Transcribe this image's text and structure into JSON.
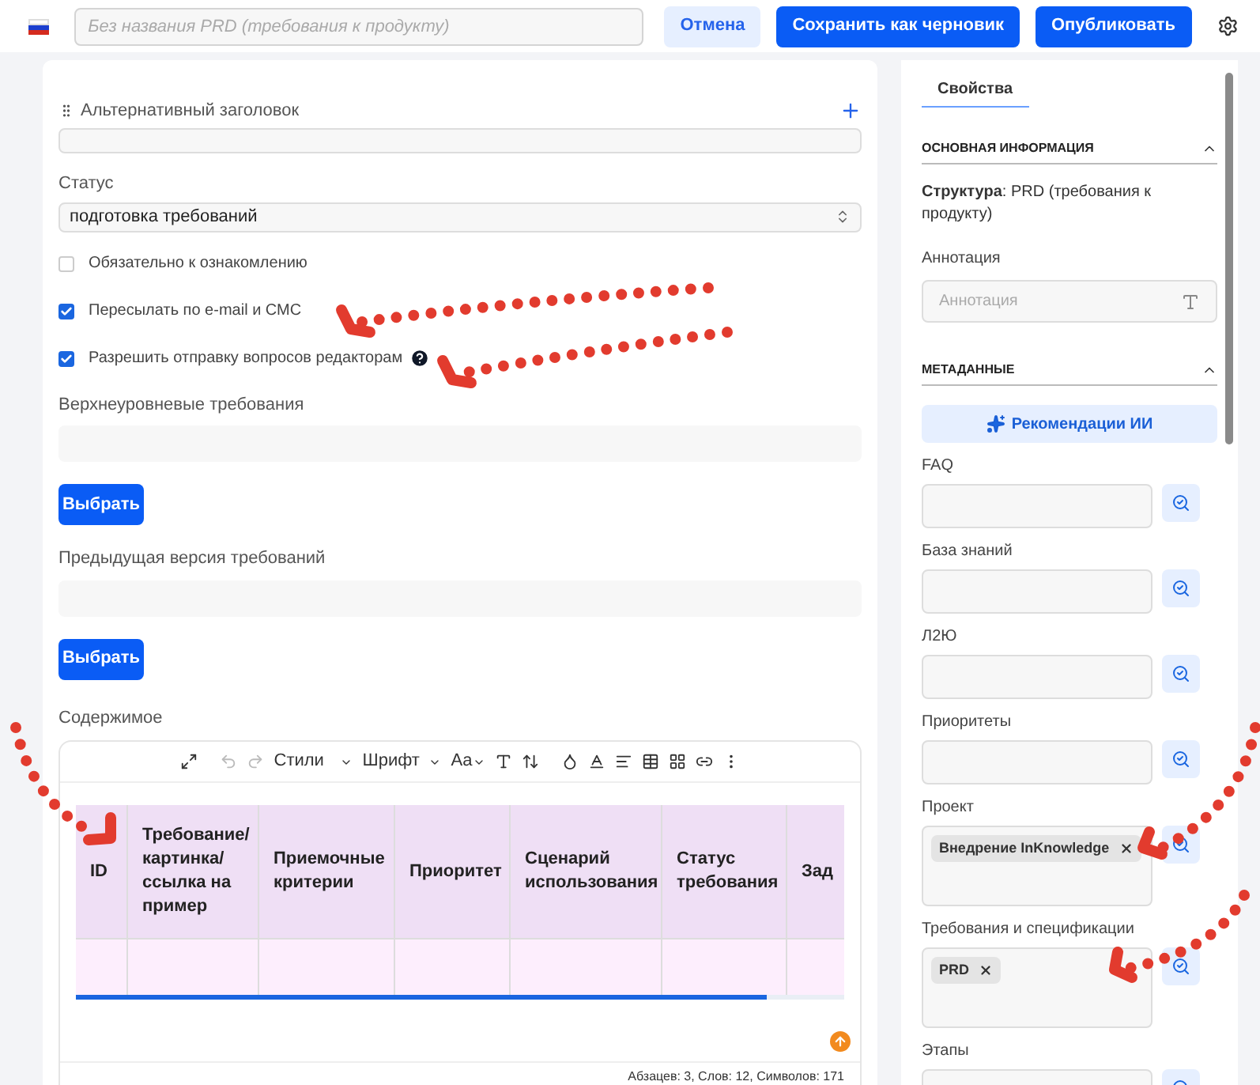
{
  "header": {
    "title_placeholder": "Без названия PRD (требования к продукту)",
    "buttons": [
      {
        "label": "Отмена",
        "kind": "secondary"
      },
      {
        "label": "Сохранить как черновик",
        "kind": "primary"
      },
      {
        "label": "Опубликовать",
        "kind": "primary"
      }
    ]
  },
  "form": {
    "alt_title": {
      "label": "Альтернативный заголовок"
    },
    "status": {
      "label": "Статус",
      "value": "подготовка требований"
    },
    "checkboxes": [
      {
        "label": "Обязательно к ознакомлению",
        "checked": false,
        "help": false
      },
      {
        "label": "Пересылать по e-mail и СМС",
        "checked": true,
        "help": false
      },
      {
        "label": "Разрешить отправку вопросов редакторам",
        "checked": true,
        "help": true
      }
    ],
    "pickers": [
      {
        "label": "Верхнеуровневые требования",
        "button": "Выбрать"
      },
      {
        "label": "Предыдущая версия требований",
        "button": "Выбрать"
      }
    ],
    "content": {
      "label": "Содержимое",
      "toolbar": {
        "styles": "Стили",
        "font": "Шрифт",
        "case": "Aa"
      },
      "columns": [
        "ID",
        "Требование/ картинка/ ссылка на пример",
        "Приемочные критерии",
        "Приоритет",
        "Сценарий использования",
        "Статус требования",
        "Зад"
      ],
      "stats": "Абзацев: 3, Слов: 12, Символов: 171"
    }
  },
  "sidebar": {
    "tabs": [
      {
        "label": "Свойства",
        "selected": true
      }
    ],
    "basic": {
      "title": "ОСНОВНАЯ ИНФОРМАЦИЯ",
      "expanded": true,
      "structure": "**Структура**: PRD (требования к продукту)",
      "annotation_label": "Аннотация",
      "annotation_placeholder": "Аннотация"
    },
    "meta": {
      "title": "МЕТАДАННЫЕ",
      "expanded": true,
      "ai_button": "Рекомендации ИИ",
      "fields": [
        {
          "label": "FAQ"
        },
        {
          "label": "База знаний"
        },
        {
          "label": "Л2Ю"
        },
        {
          "label": "Приоритеты"
        },
        {
          "label": "Проект",
          "tags": [
            "Внедрение InKnowledge"
          ]
        },
        {
          "label": "Требования и спецификации",
          "tags": [
            "PRD"
          ]
        },
        {
          "label": "Этапы"
        }
      ]
    }
  }
}
